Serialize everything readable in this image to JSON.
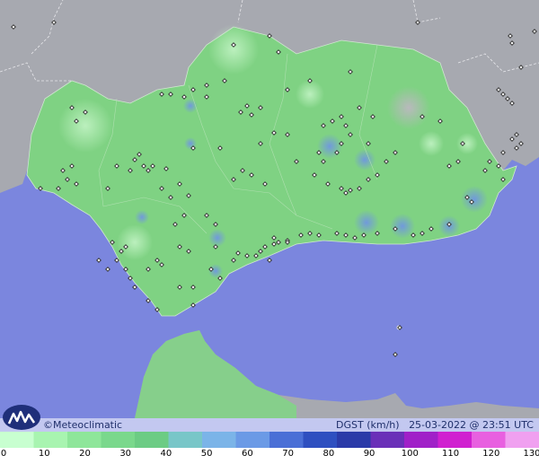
{
  "brand": {
    "text": "©Meteoclimatic",
    "logo_icon": "meteoclimatic-logo-icon"
  },
  "status": {
    "variable": "DGST (km/h)",
    "datetime": "25-03-2022 @ 23:51 UTC"
  },
  "colors": {
    "sea": "#7b86de",
    "land_outside": "#a7a9b0",
    "land_region": "#7fd283",
    "station_marker": "#2a2a2a"
  },
  "legend": {
    "unit": "km/h",
    "labels": [
      "0",
      "10",
      "20",
      "30",
      "40",
      "50",
      "60",
      "70",
      "80",
      "90",
      "100",
      "110",
      "120",
      "130"
    ],
    "range": [
      0,
      130
    ],
    "colors": [
      "#c8ffd0",
      "#a8f4b0",
      "#8ee69a",
      "#7ad88c",
      "#6ccc84",
      "#78c6c8",
      "#7bb4e8",
      "#6b9ae6",
      "#4a6fd6",
      "#2e4fc0",
      "#2a3aa8",
      "#6a30b8",
      "#a020c8",
      "#d020d0",
      "#e860e0",
      "#f0a0f0"
    ]
  }
}
